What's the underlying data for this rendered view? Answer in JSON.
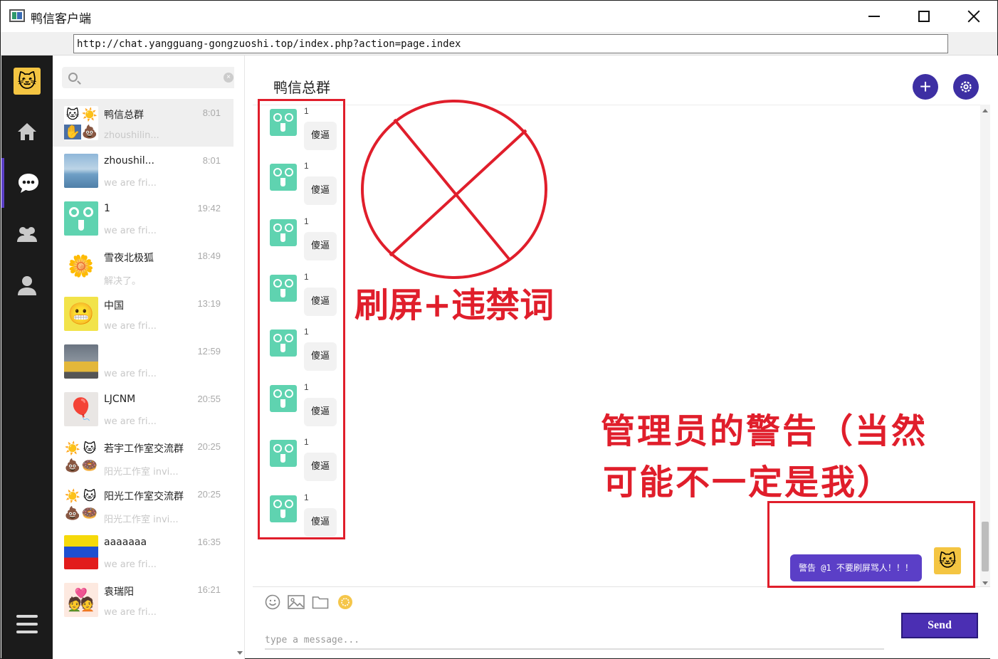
{
  "window": {
    "title": "鸭信客户端"
  },
  "address_bar": {
    "url": "http://chat.yangguang-gongzuoshi.top/index.php?action=page.index"
  },
  "rail": {
    "avatar_icon": "cat-face-icon",
    "items": [
      {
        "name": "home",
        "icon": "home-icon"
      },
      {
        "name": "chat",
        "icon": "chat-bubble-icon",
        "active": true
      },
      {
        "name": "groups",
        "icon": "group-icon"
      },
      {
        "name": "profile",
        "icon": "user-icon"
      }
    ],
    "menu_icon": "hamburger-icon"
  },
  "search": {
    "placeholder": ""
  },
  "conversations": [
    {
      "name": "鸭信总群",
      "time": "8:01",
      "preview": "zhoushilin...",
      "selected": true,
      "avatar": "group-collage"
    },
    {
      "name": "zhoushil...",
      "time": "8:01",
      "preview": "we are fri...",
      "avatar": "lake-landscape"
    },
    {
      "name": "1",
      "time": "19:42",
      "preview": "we are fri...",
      "avatar": "green-face"
    },
    {
      "name": "雪夜北极狐",
      "time": "18:49",
      "preview": "解决了。",
      "avatar": "flower-face"
    },
    {
      "name": "中国",
      "time": "13:19",
      "preview": "we are fri...",
      "avatar": "sponge-face"
    },
    {
      "name": "",
      "time": "12:59",
      "preview": "we are fri...",
      "avatar": "train"
    },
    {
      "name": "LJCNM",
      "time": "20:55",
      "preview": "we are fri...",
      "avatar": "balloon-girl"
    },
    {
      "name": "若宇工作室交流群",
      "time": "20:25",
      "preview": "阳光工作室 invi...",
      "avatar": "group-collage"
    },
    {
      "name": "阳光工作室交流群",
      "time": "20:25",
      "preview": "阳光工作室 invi...",
      "avatar": "group-collage"
    },
    {
      "name": "aaaaaaa",
      "time": "16:35",
      "preview": "we are fri...",
      "avatar": "flag-stripes"
    },
    {
      "name": "袁瑞阳",
      "time": "16:21",
      "preview": "we are fri...",
      "avatar": "couple-heart"
    }
  ],
  "chat": {
    "title": "鸭信总群",
    "add_icon": "plus-icon",
    "settings_icon": "gear-icon",
    "messages": [
      {
        "sender": "1",
        "text": "傻逼"
      },
      {
        "sender": "1",
        "text": "傻逼"
      },
      {
        "sender": "1",
        "text": "傻逼"
      },
      {
        "sender": "1",
        "text": "傻逼"
      },
      {
        "sender": "1",
        "text": "傻逼"
      },
      {
        "sender": "1",
        "text": "傻逼"
      },
      {
        "sender": "1",
        "text": "傻逼"
      },
      {
        "sender": "1",
        "text": "傻逼"
      }
    ],
    "my_message": {
      "text": "警告 @1 不要刷屏骂人！！！"
    }
  },
  "composer": {
    "tools": [
      "smile-icon",
      "image-icon",
      "file-icon",
      "gift-icon"
    ],
    "placeholder": "type a message...",
    "send_label": "Send"
  },
  "annotations": {
    "label_spam": "刷屏+违禁词",
    "label_warning_line1": "管理员的警告（当然",
    "label_warning_line2": "可能不一定是我）",
    "color": "#e01e2b"
  },
  "colors": {
    "accent": "#5b3fc7",
    "rail_bg": "#1b1b1b",
    "avatar_green": "#5fd3b0"
  }
}
